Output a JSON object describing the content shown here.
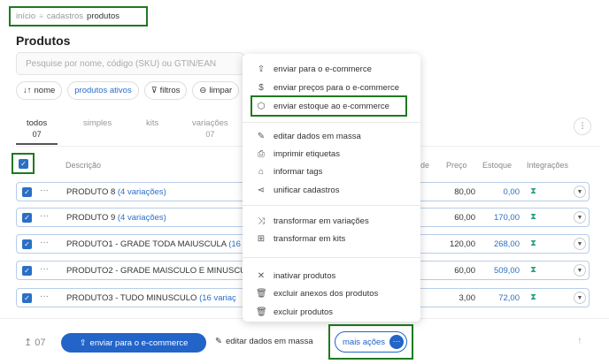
{
  "breadcrumb": {
    "items": [
      "início",
      "cadastros"
    ],
    "current": "produtos"
  },
  "page_title": "Produtos",
  "search": {
    "placeholder": "Pesquise por nome, código (SKU) ou GTIN/EAN"
  },
  "filters": [
    {
      "label": "nome",
      "icon": "sort-icon"
    },
    {
      "label": "produtos ativos"
    },
    {
      "label": "filtros",
      "icon": "filter-icon"
    },
    {
      "label": "limpar",
      "icon": "clear-icon"
    }
  ],
  "tabs": [
    {
      "label": "todos",
      "count": "07"
    },
    {
      "label": "simples",
      "count": ""
    },
    {
      "label": "kits",
      "count": ""
    },
    {
      "label": "variações",
      "count": "07"
    }
  ],
  "table": {
    "headers": {
      "description": "Descrição",
      "unit": "de",
      "price": "Preço",
      "stock": "Estoque",
      "integrations": "Integrações"
    },
    "rows": [
      {
        "name": "PRODUTO 8 ",
        "variations": "(4 variações)",
        "price": "80,00",
        "stock": "0,00"
      },
      {
        "name": "PRODUTO 9 ",
        "variations": "(4 variações)",
        "price": "60,00",
        "stock": "170,00"
      },
      {
        "name": "PRODUTO1 - GRADE TODA MAIUSCULA ",
        "variations": "(16",
        "price": "120,00",
        "stock": "268,00"
      },
      {
        "name": "PRODUTO2 - GRADE MAISCULO E MINUSCU",
        "variations": "",
        "price": "60,00",
        "stock": "509,00"
      },
      {
        "name": "PRODUTO3 - TUDO MINUSCULO ",
        "variations": "(16 variaç",
        "price": "3,00",
        "stock": "72,00"
      }
    ]
  },
  "menu": {
    "items": [
      {
        "label": "enviar para o e-commerce",
        "icon": "upload-icon"
      },
      {
        "label": "enviar preços para o e-commerce",
        "icon": "dollar-icon"
      },
      {
        "label": "enviar estoque ao e-commerce",
        "icon": "box-icon"
      },
      {
        "label": "editar dados em massa",
        "icon": "edit-icon"
      },
      {
        "label": "imprimir etiquetas",
        "icon": "print-icon"
      },
      {
        "label": "informar tags",
        "icon": "tag-icon"
      },
      {
        "label": "unificar cadastros",
        "icon": "merge-icon"
      },
      {
        "label": "transformar em variações",
        "icon": "shuffle-icon"
      },
      {
        "label": "transformar em kits",
        "icon": "grid-icon"
      },
      {
        "label": "inativar produtos",
        "icon": "x-icon"
      },
      {
        "label": "excluir anexos dos produtos",
        "icon": "trash-icon"
      },
      {
        "label": "excluir produtos",
        "icon": "trash-icon"
      }
    ]
  },
  "bottom_bar": {
    "selected_count": "07",
    "send_label": "enviar para o e-commerce",
    "edit_label": "editar dados em massa",
    "more_label": "mais ações"
  },
  "colors": {
    "primary": "#2264c8",
    "highlight_box": "#1e7a1e",
    "link": "#2b6fc5"
  }
}
